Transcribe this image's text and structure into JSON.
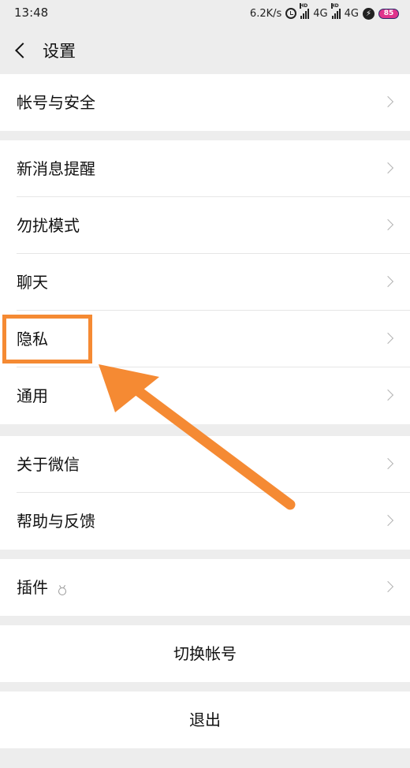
{
  "status_bar": {
    "time": "13:48",
    "speed": "6.2K/s",
    "hd_label": "HD",
    "network_1": "4G",
    "network_2": "4G",
    "battery": "85"
  },
  "header": {
    "title": "设置",
    "back_icon": "chevron-left-icon"
  },
  "groups": [
    {
      "items": [
        {
          "label": "帐号与安全"
        }
      ]
    },
    {
      "items": [
        {
          "label": "新消息提醒"
        },
        {
          "label": "勿扰模式"
        },
        {
          "label": "聊天"
        },
        {
          "label": "隐私"
        },
        {
          "label": "通用"
        }
      ]
    },
    {
      "items": [
        {
          "label": "关于微信"
        },
        {
          "label": "帮助与反馈"
        }
      ]
    },
    {
      "items": [
        {
          "label": "插件",
          "icon": "plugin-icon"
        }
      ]
    }
  ],
  "actions": {
    "switch_account": "切换帐号",
    "logout": "退出"
  },
  "annotation": {
    "highlighted_item": "隐私",
    "color": "#f58a33"
  },
  "colors": {
    "background": "#ededed",
    "row_background": "#ffffff",
    "separator": "#e6e6e6",
    "chevron": "#b3b3b3",
    "battery": "#e0348c"
  }
}
